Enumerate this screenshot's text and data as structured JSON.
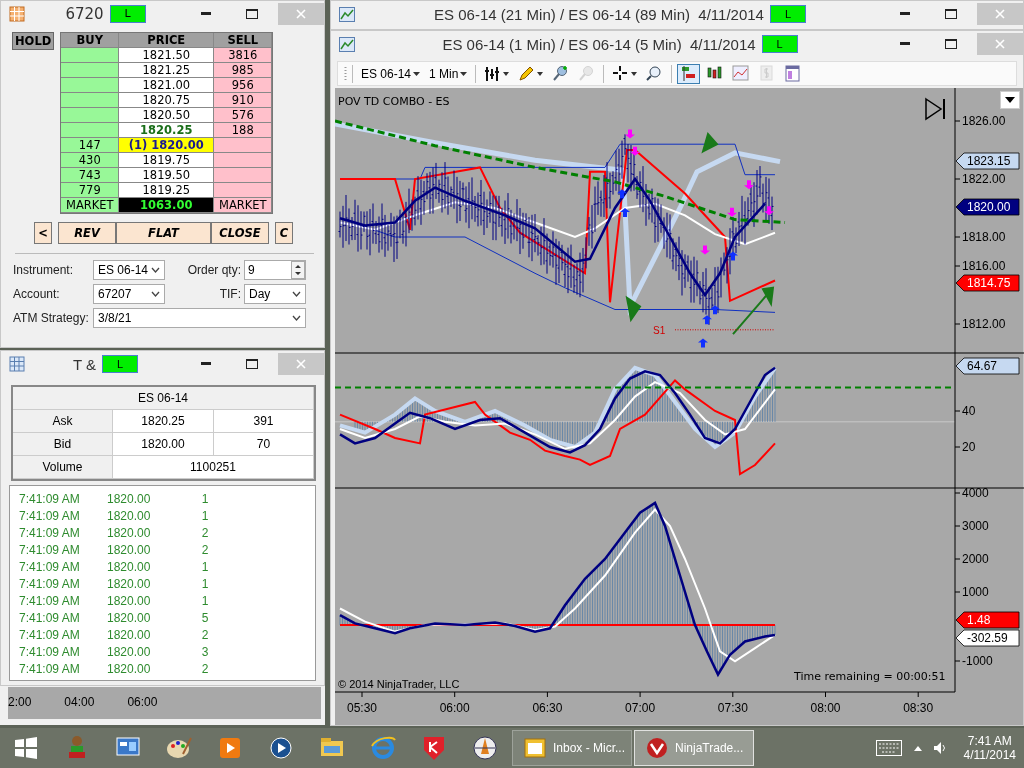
{
  "dom_window": {
    "title": "6720",
    "badge": "L",
    "hold": "HOLD",
    "columns": [
      "BUY",
      "PRICE",
      "SELL"
    ],
    "rows": [
      {
        "kind": "ask",
        "price": "1821.50",
        "sell": "3816"
      },
      {
        "kind": "ask",
        "price": "1821.25",
        "sell": "985"
      },
      {
        "kind": "ask",
        "price": "1821.00",
        "sell": "956"
      },
      {
        "kind": "ask",
        "price": "1820.75",
        "sell": "910"
      },
      {
        "kind": "ask",
        "price": "1820.50",
        "sell": "576"
      },
      {
        "kind": "best_ask",
        "price": "1820.25",
        "sell": "188"
      },
      {
        "kind": "last",
        "buy": "147",
        "price": "(1) 1820.00"
      },
      {
        "kind": "bid",
        "buy": "430",
        "price": "1819.75"
      },
      {
        "kind": "bid",
        "buy": "743",
        "price": "1819.50"
      },
      {
        "kind": "bid",
        "buy": "779",
        "price": "1819.25"
      },
      {
        "kind": "market",
        "buy": "MARKET",
        "price": "1063.00",
        "sell": "MARKET"
      }
    ],
    "buttons": [
      "<",
      "REV",
      "FLAT",
      "CLOSE",
      "C"
    ],
    "instrument": {
      "label": "Instrument:",
      "value": "ES 06-14"
    },
    "order_qty": {
      "label": "Order qty:",
      "value": "9"
    },
    "account": {
      "label": "Account:",
      "value": "67207"
    },
    "tif": {
      "label": "TIF:",
      "value": "Day"
    },
    "atm_strategy": {
      "label": "ATM Strategy:",
      "value": "3/8/21"
    }
  },
  "ts_window": {
    "title": "T &",
    "badge": "L",
    "instrument": "ES 06-14",
    "quotes": [
      {
        "label": "Ask",
        "price": "1820.25",
        "size": "391"
      },
      {
        "label": "Bid",
        "price": "1820.00",
        "size": "70"
      }
    ],
    "volume": {
      "label": "Volume",
      "value": "1100251"
    },
    "trades": [
      {
        "time": "7:41:09 AM",
        "price": "1820.00",
        "size": "1"
      },
      {
        "time": "7:41:09 AM",
        "price": "1820.00",
        "size": "1"
      },
      {
        "time": "7:41:09 AM",
        "price": "1820.00",
        "size": "2"
      },
      {
        "time": "7:41:09 AM",
        "price": "1820.00",
        "size": "2"
      },
      {
        "time": "7:41:09 AM",
        "price": "1820.00",
        "size": "1"
      },
      {
        "time": "7:41:09 AM",
        "price": "1820.00",
        "size": "1"
      },
      {
        "time": "7:41:09 AM",
        "price": "1820.00",
        "size": "1"
      },
      {
        "time": "7:41:09 AM",
        "price": "1820.00",
        "size": "5"
      },
      {
        "time": "7:41:09 AM",
        "price": "1820.00",
        "size": "2"
      },
      {
        "time": "7:41:09 AM",
        "price": "1820.00",
        "size": "3"
      },
      {
        "time": "7:41:09 AM",
        "price": "1820.00",
        "size": "2"
      }
    ]
  },
  "background_chart": {
    "time_axis": [
      "2:00",
      "04:00",
      "06:00"
    ]
  },
  "back_chart_window": {
    "title": "ES 06-14 (21 Min) / ES 06-14 (89 Min)  4/11/2014",
    "badge": "L"
  },
  "chart_window": {
    "title": "ES 06-14 (1 Min) / ES 06-14 (5 Min)  4/11/2014",
    "badge": "L",
    "instrument": "ES 06-14",
    "interval": "1 Min",
    "tool_buttons": [
      {
        "selected": false,
        "disabled": false
      },
      {
        "selected": false,
        "disabled": false
      },
      {
        "selected": false,
        "disabled": false
      },
      {
        "selected": false,
        "disabled": true
      },
      {
        "selected": false,
        "disabled": false
      },
      {
        "selected": false,
        "disabled": false
      },
      {
        "selected": true,
        "disabled": false
      },
      {
        "selected": false,
        "disabled": false
      },
      {
        "selected": false,
        "disabled": false
      },
      {
        "selected": false,
        "disabled": true
      },
      {
        "selected": false,
        "disabled": false
      }
    ],
    "indicator_label": "POV TD COMBO - ES",
    "price_axis": [
      "1826.00",
      "1822.00",
      "1818.00",
      "1816.00",
      "1812.00"
    ],
    "price_tags": [
      {
        "value": "1823.15",
        "color": "#c6d9f1"
      },
      {
        "value": "1820.00",
        "color": "#000080"
      },
      {
        "value": "1814.75",
        "color": "#ff0000"
      }
    ],
    "signal_label": "S1",
    "oscillator_axis": [
      "40",
      "20"
    ],
    "oscillator_tags": [
      {
        "value": "64.67",
        "color": "#c6d9f1"
      }
    ],
    "lower_axis": [
      "4000",
      "3000",
      "2000",
      "1000",
      "-1000"
    ],
    "lower_tags": [
      {
        "value": "1.48",
        "color": "#ff0000"
      },
      {
        "value": "-302.59",
        "color": "#ffffff"
      }
    ],
    "time_axis": [
      "05:30",
      "06:00",
      "06:30",
      "07:00",
      "07:30",
      "08:00",
      "08:30"
    ],
    "copyright": "© 2014 NinjaTrader, LLC",
    "time_remaining": "Time remaining = 00:00:51"
  },
  "taskbar": {
    "tasks": [
      {
        "label": "Inbox - Micr...",
        "selected": false
      },
      {
        "label": "NinjaTrade...",
        "selected": true
      }
    ],
    "time": "7:41 AM",
    "date": "4/11/2014"
  }
}
